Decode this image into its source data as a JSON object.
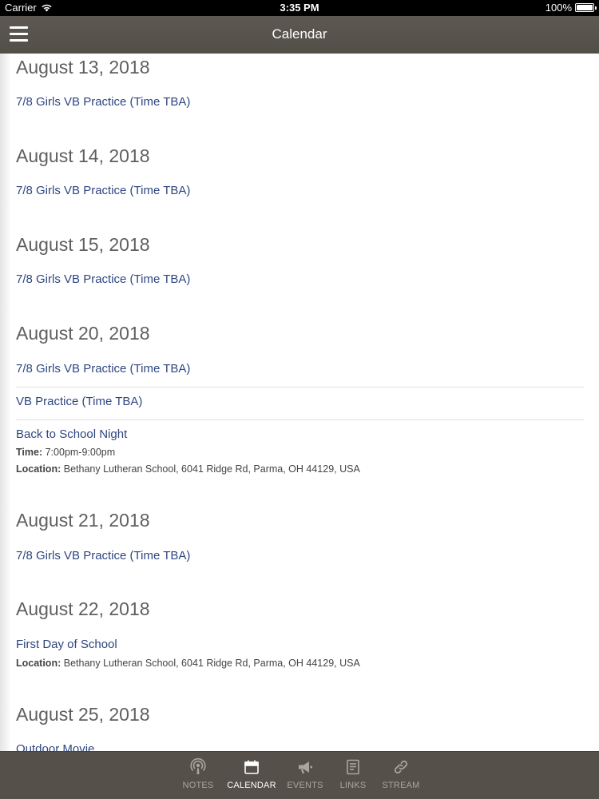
{
  "status_bar": {
    "carrier": "Carrier",
    "time": "3:35 PM",
    "battery": "100%"
  },
  "nav": {
    "title": "Calendar"
  },
  "days": [
    {
      "date": "August 13, 2018",
      "events": [
        {
          "title": "7/8 Girls VB Practice (Time TBA)"
        }
      ]
    },
    {
      "date": "August 14, 2018",
      "events": [
        {
          "title": "7/8 Girls VB Practice (Time TBA)"
        }
      ]
    },
    {
      "date": "August 15, 2018",
      "events": [
        {
          "title": "7/8 Girls VB Practice (Time TBA)"
        }
      ]
    },
    {
      "date": "August 20, 2018",
      "events": [
        {
          "title": "7/8 Girls VB Practice (Time TBA)"
        },
        {
          "title": "VB Practice (Time TBA)"
        },
        {
          "title": "Back to School Night",
          "time_label": "Time:",
          "time": "7:00pm-9:00pm",
          "location_label": "Location:",
          "location": "Bethany Lutheran School, 6041 Ridge Rd, Parma, OH 44129, USA"
        }
      ]
    },
    {
      "date": "August 21, 2018",
      "events": [
        {
          "title": "7/8 Girls VB Practice (Time TBA)"
        }
      ]
    },
    {
      "date": "August 22, 2018",
      "events": [
        {
          "title": "First Day of School",
          "location_label": "Location:",
          "location": "Bethany Lutheran School, 6041 Ridge Rd, Parma, OH 44129, USA"
        }
      ]
    },
    {
      "date": "August 25, 2018",
      "events": [
        {
          "title": "Outdoor Movie"
        }
      ]
    }
  ],
  "tabs": [
    {
      "label": "NOTES",
      "icon": "podcast-icon",
      "active": false
    },
    {
      "label": "CALENDAR",
      "icon": "calendar-icon",
      "active": true
    },
    {
      "label": "EVENTS",
      "icon": "megaphone-icon",
      "active": false
    },
    {
      "label": "LINKS",
      "icon": "document-icon",
      "active": false
    },
    {
      "label": "STREAM",
      "icon": "link-icon",
      "active": false
    }
  ],
  "colors": {
    "nav_bg": "#57524c",
    "tab_bg": "#555049",
    "link": "#2e4680",
    "heading": "#5f5f5f"
  }
}
